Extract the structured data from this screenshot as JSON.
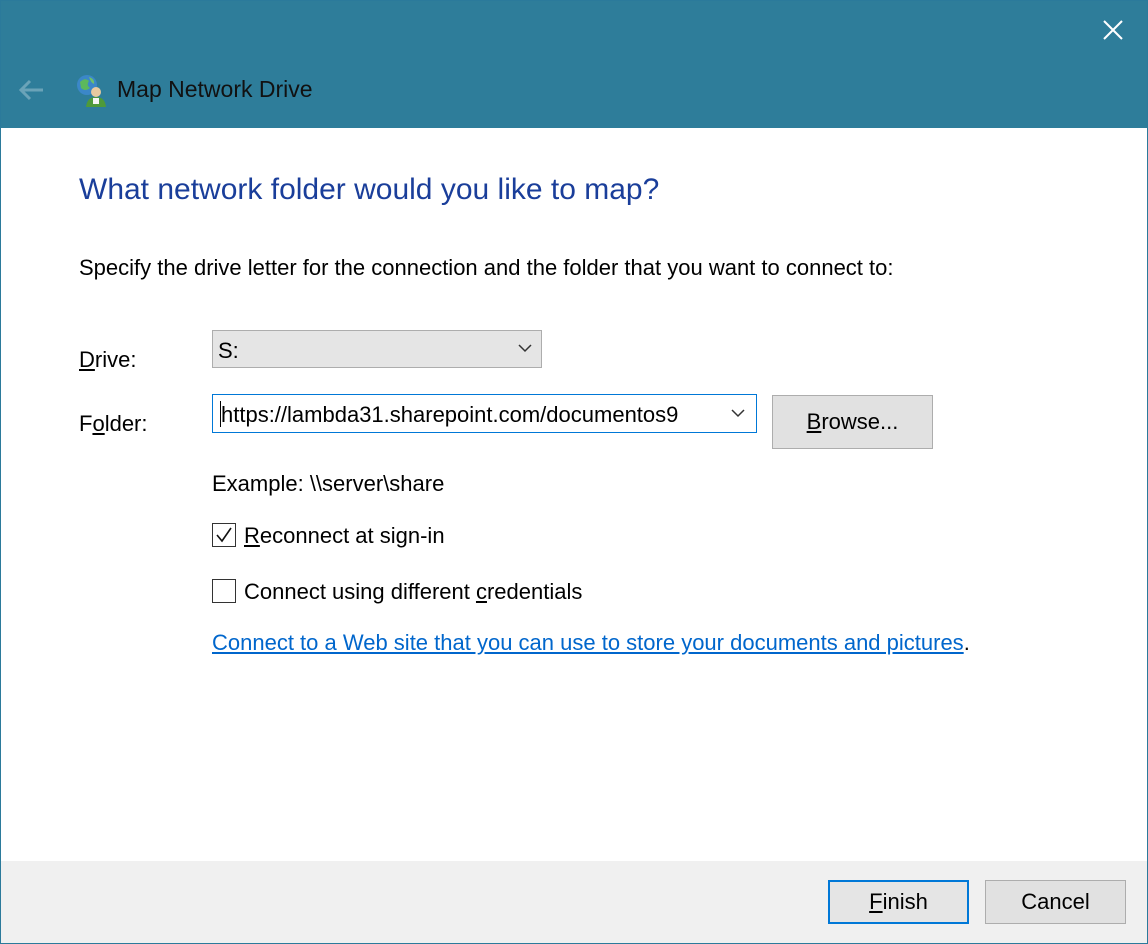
{
  "window": {
    "title": "Map Network Drive",
    "close_icon": "close-icon",
    "back_icon": "back-arrow-icon",
    "app_icon": "network-drive-icon"
  },
  "page": {
    "heading": "What network folder would you like to map?",
    "instructions": "Specify the drive letter for the connection and the folder that you want to connect to:"
  },
  "drive": {
    "label_mn": "D",
    "label_rest": "rive:",
    "value": "S:"
  },
  "folder": {
    "label_pre": "F",
    "label_mn": "o",
    "label_rest": "lder:",
    "value": "https://lambda31.sharepoint.com/documentos9",
    "browse_mn": "B",
    "browse_rest": "rowse..."
  },
  "example": "Example: \\\\server\\share",
  "reconnect": {
    "checked": true,
    "label_mn": "R",
    "label_rest": "econnect at sign-in"
  },
  "credentials": {
    "checked": false,
    "label_pre": "Connect using different ",
    "label_mn": "c",
    "label_rest": "redentials"
  },
  "link": {
    "text": "Connect to a Web site that you can use to store your documents and pictures",
    "suffix": "."
  },
  "footer": {
    "finish_mn": "F",
    "finish_rest": "inish",
    "cancel": "Cancel"
  },
  "colors": {
    "titlebar": "#2e7d9a",
    "heading": "#1a3e9a",
    "link": "#0066cc",
    "focus": "#0078d7"
  }
}
